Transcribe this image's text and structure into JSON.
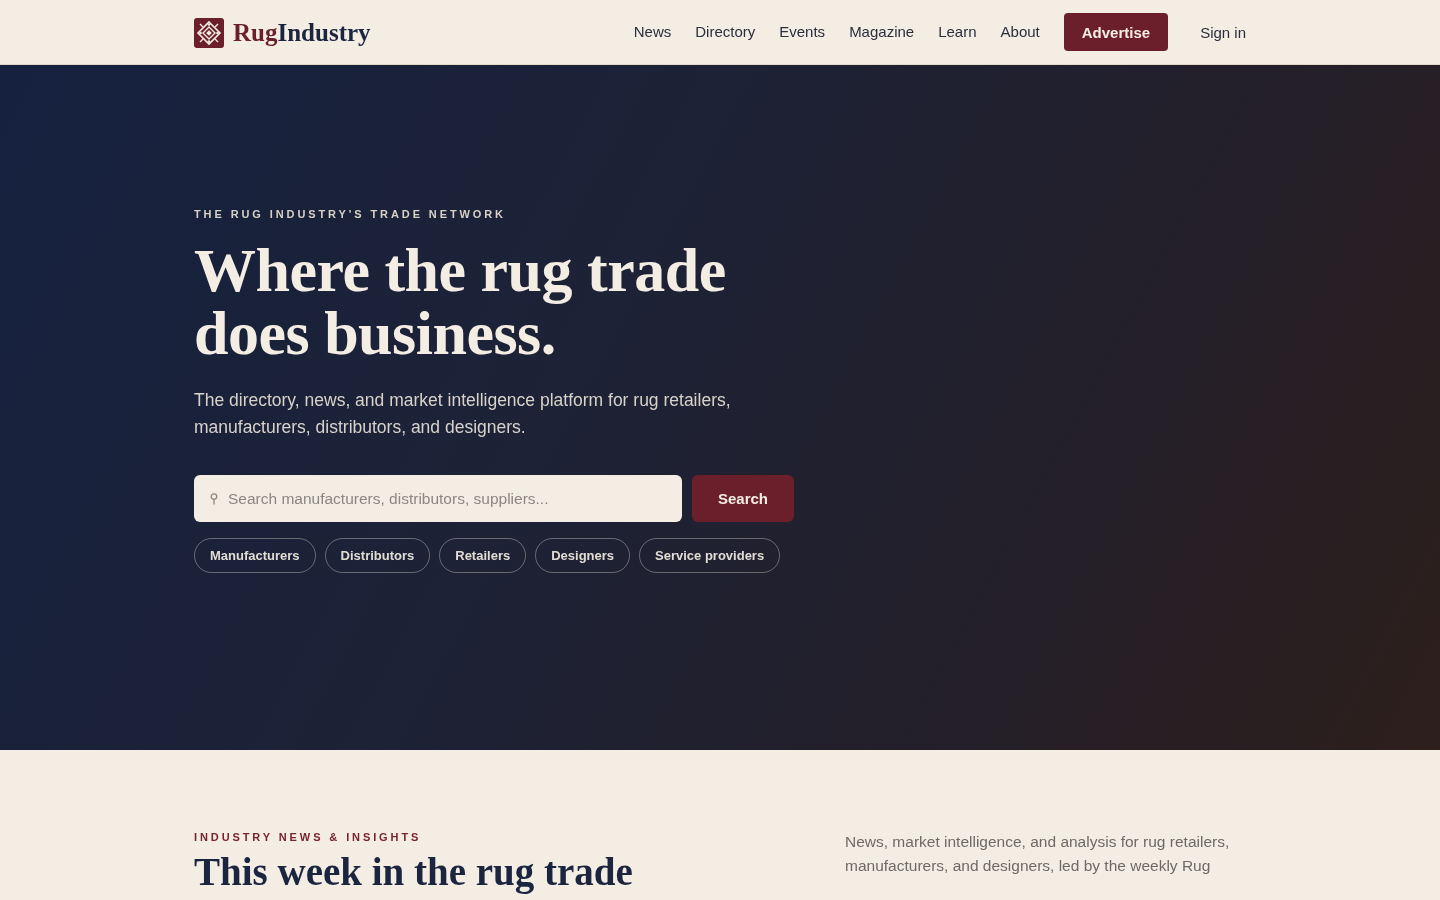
{
  "header": {
    "logo": {
      "part_1": "Rug",
      "part_2": "Industry"
    },
    "nav": [
      {
        "label": "News"
      },
      {
        "label": "Directory"
      },
      {
        "label": "Events"
      },
      {
        "label": "Magazine"
      },
      {
        "label": "Learn"
      },
      {
        "label": "About"
      }
    ],
    "advertise_button": "Advertise",
    "sign_in": "Sign in"
  },
  "hero": {
    "eyebrow": "THE RUG INDUSTRY'S TRADE NETWORK",
    "title": "Where the rug trade does business.",
    "subtitle": "The directory, news, and market intelligence platform for rug retailers, manufacturers, distributors, and designers.",
    "search": {
      "placeholder": "Search manufacturers, distributors, suppliers...",
      "button": "Search"
    },
    "categories": [
      {
        "label": "Manufacturers"
      },
      {
        "label": "Distributors"
      },
      {
        "label": "Retailers"
      },
      {
        "label": "Designers"
      },
      {
        "label": "Service providers"
      }
    ]
  },
  "news_section": {
    "eyebrow": "INDUSTRY NEWS & INSIGHTS",
    "title": "This week in the rug trade",
    "intro": "News, market intelligence, and analysis for rug retailers, manufacturers, and designers, led by the weekly Rug"
  }
}
